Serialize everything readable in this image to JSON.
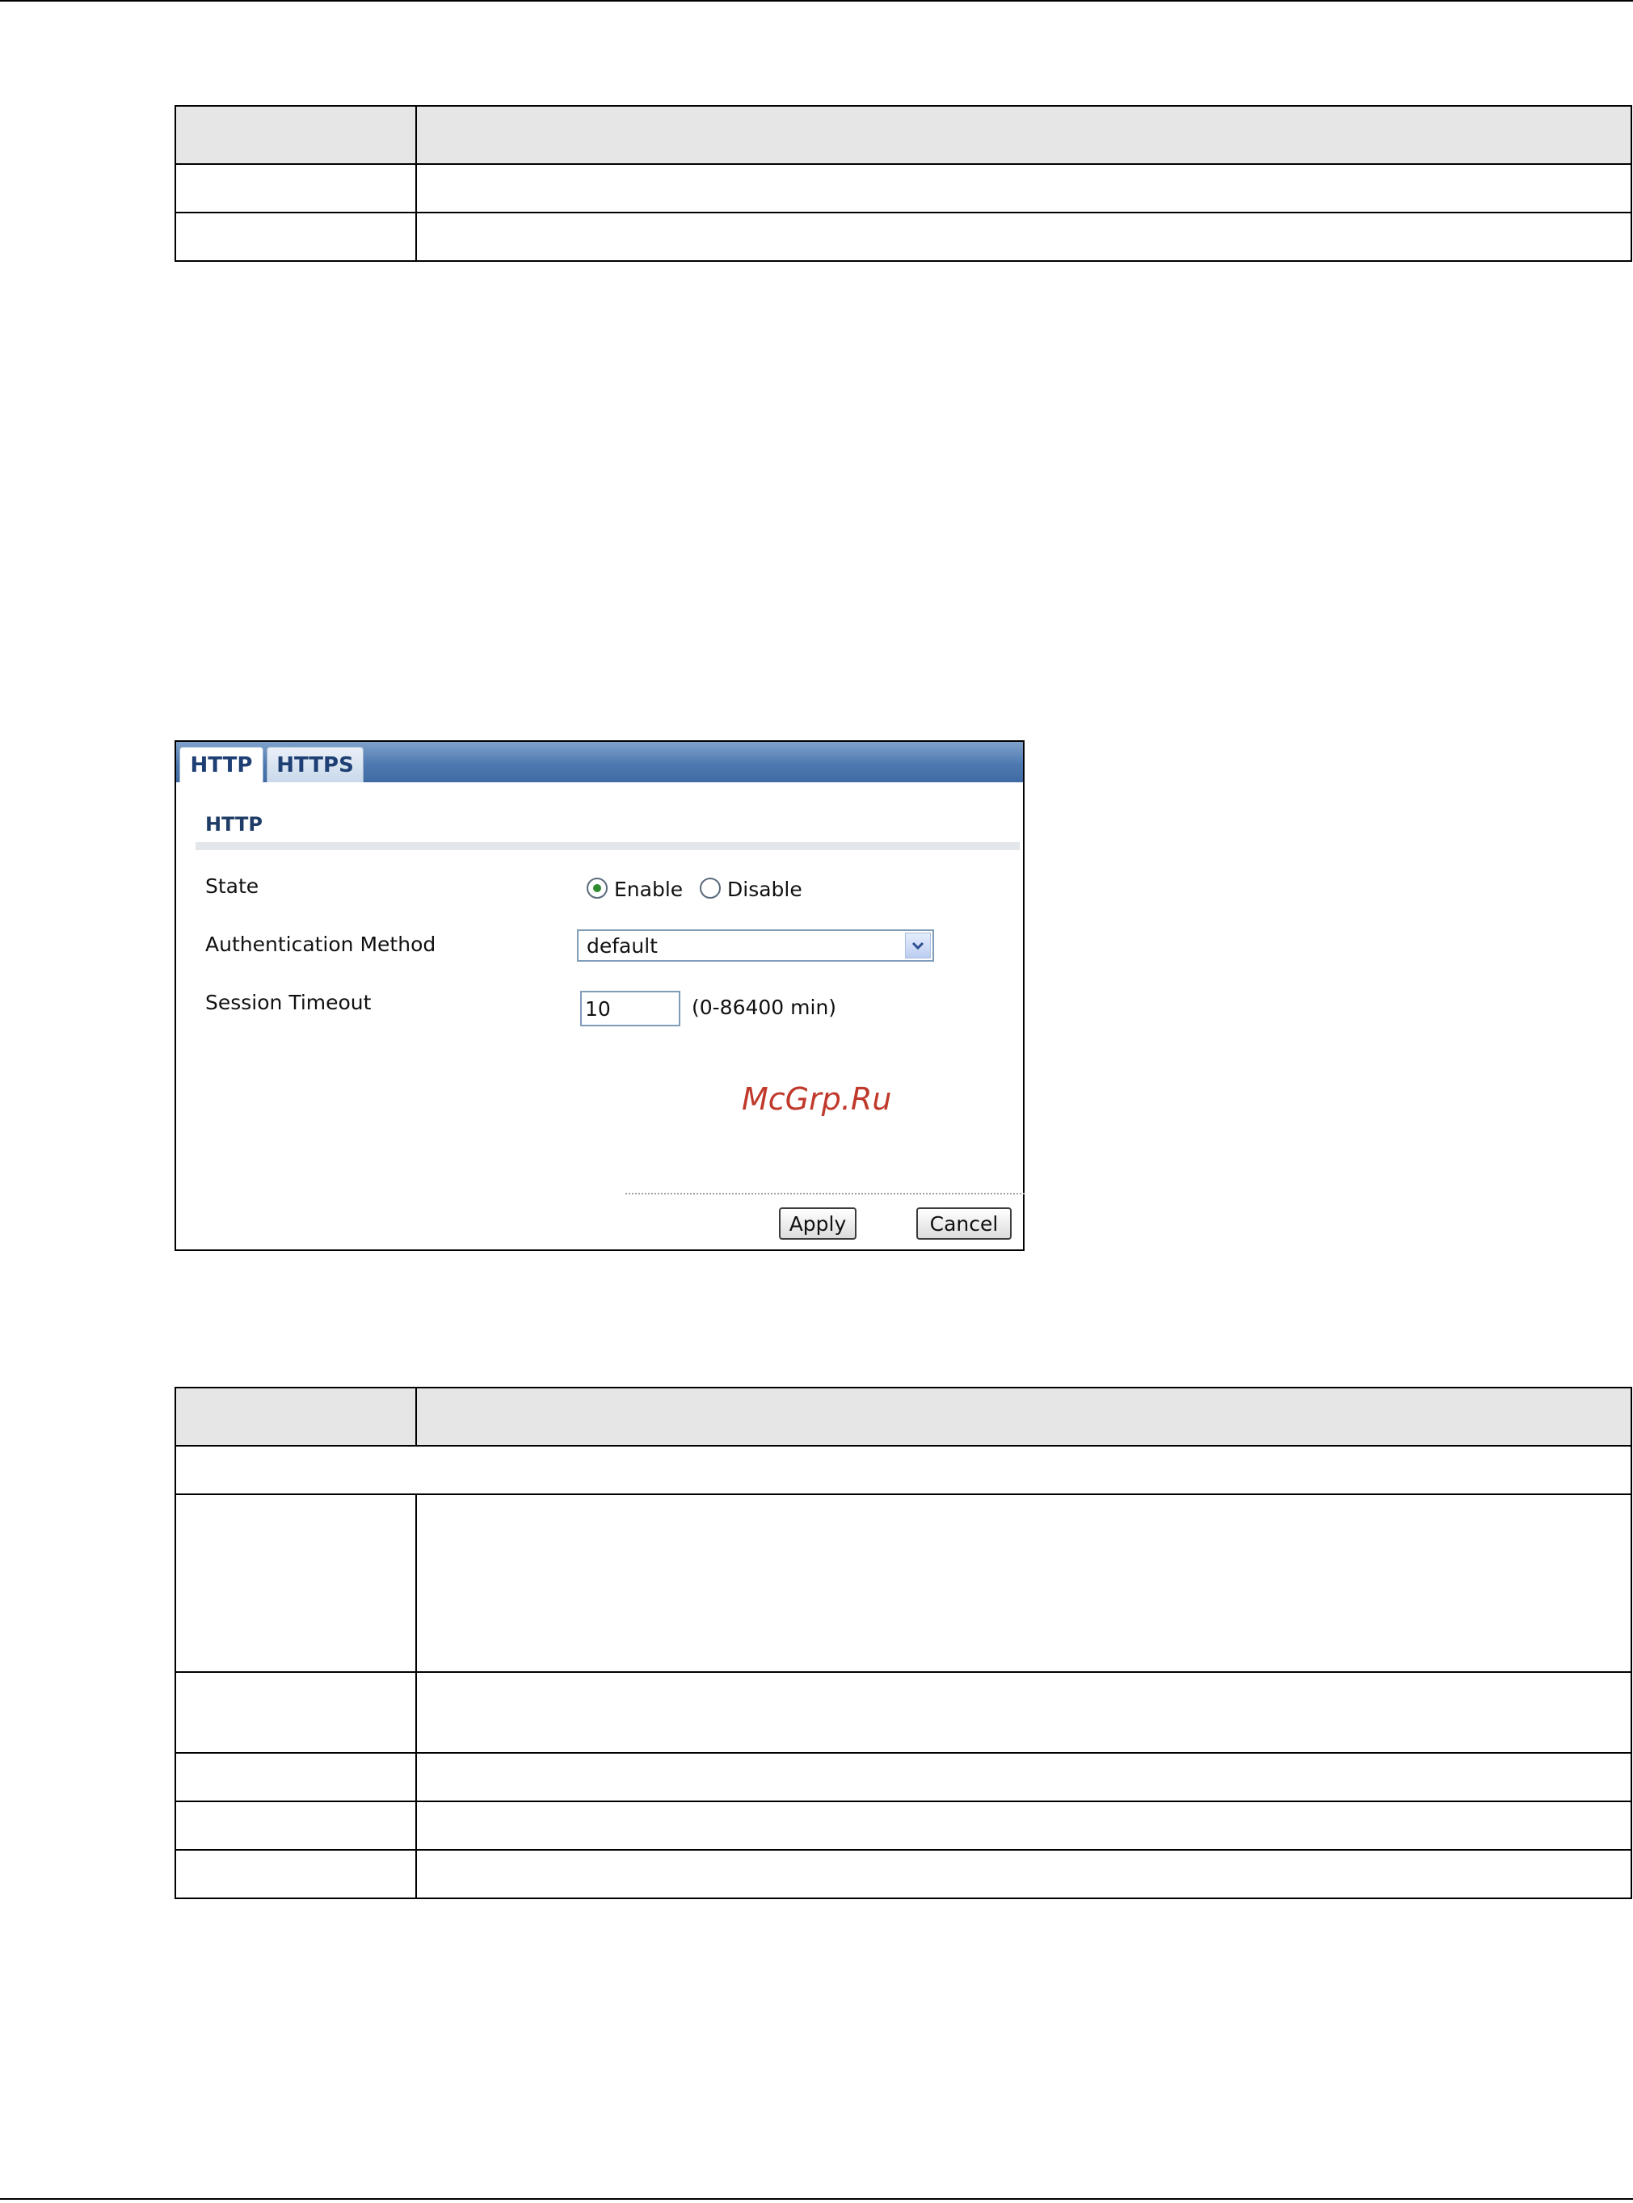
{
  "panel": {
    "tabs": [
      {
        "label": "HTTP",
        "active": true
      },
      {
        "label": "HTTPS",
        "active": false
      }
    ],
    "section_title": "HTTP",
    "state": {
      "label": "State",
      "options": [
        "Enable",
        "Disable"
      ],
      "selected": "Enable"
    },
    "auth": {
      "label": "Authentication Method",
      "value": "default"
    },
    "timeout": {
      "label": "Session Timeout",
      "value": "10",
      "hint": "(0-86400 min)"
    },
    "watermark": "McGrp.Ru",
    "buttons": {
      "apply": "Apply",
      "cancel": "Cancel"
    }
  }
}
